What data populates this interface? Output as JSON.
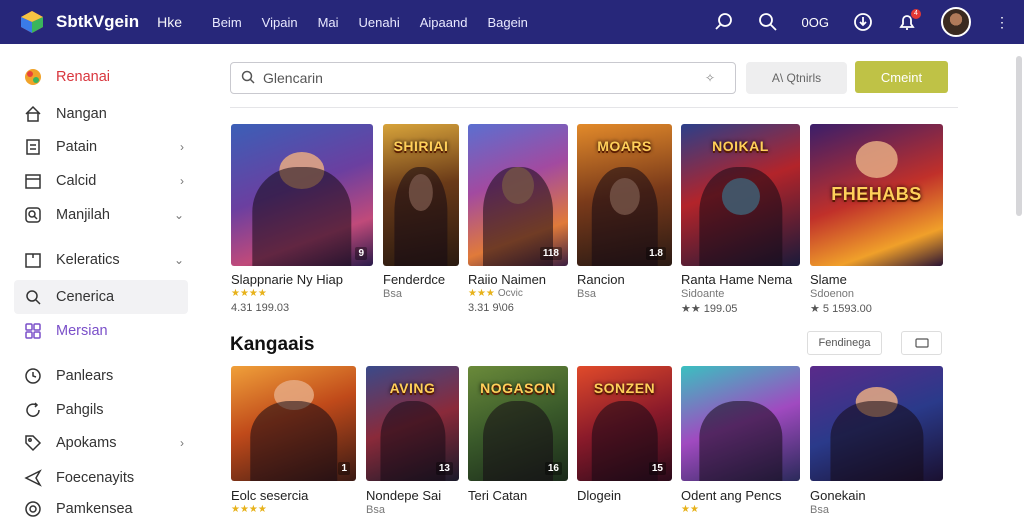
{
  "header": {
    "brand": "SbtkVgein",
    "brand_sub": "Hke",
    "nav": [
      "Beim",
      "Vipain",
      "Mai",
      "Uenahi",
      "Aipaand",
      "Bagein"
    ],
    "count": "0OG",
    "notification_badge": "4",
    "accent": "#27277a"
  },
  "sidebar": {
    "items": [
      {
        "label": "Renanai",
        "icon": "joystick-icon"
      },
      {
        "label": "Nangan",
        "icon": "home-icon"
      },
      {
        "label": "Patain",
        "icon": "document-icon",
        "chevron": "›"
      },
      {
        "label": "Calcid",
        "icon": "calendar-icon",
        "chevron": "›"
      },
      {
        "label": "Manjilah",
        "icon": "search-icon",
        "chevron": "⌄"
      },
      {
        "label": "Keleratics",
        "icon": "box-icon",
        "chevron": "⌄"
      },
      {
        "label": "Cenerica",
        "icon": "search-icon"
      },
      {
        "label": "Mersian",
        "icon": "grid-icon"
      },
      {
        "label": "Panlears",
        "icon": "clock-icon"
      },
      {
        "label": "Pahgils",
        "icon": "refresh-icon"
      },
      {
        "label": "Apokams",
        "icon": "tag-icon",
        "chevron": "›"
      },
      {
        "label": "Foecenayits",
        "icon": "send-icon"
      },
      {
        "label": "Pamkensea",
        "icon": "settings-icon"
      }
    ]
  },
  "toolbar": {
    "search_placeholder": "Glencarin",
    "filter_label": "A\\ Qtnirls",
    "cta_label": "Cmeint"
  },
  "row1": [
    {
      "name": "Slappnarie Ny Hiap",
      "stars": "★★★★",
      "meta": "",
      "price": "4.31 199.03",
      "tag": "9",
      "cover_title": ""
    },
    {
      "name": "Fenderdce",
      "stars": "",
      "meta": "Bsa",
      "price": "",
      "tag": "",
      "cover_title": "SHIRIAI"
    },
    {
      "name": "Raiio Naimen",
      "stars": "★★★",
      "meta": "Ocvic",
      "price": "3.31 9\\06",
      "tag": "118",
      "cover_title": ""
    },
    {
      "name": "Rancion",
      "stars": "",
      "meta": "Bsa",
      "price": "",
      "tag": "1.8",
      "cover_title": "MOARS"
    },
    {
      "name": "Ranta Hame Nema",
      "stars": "★★",
      "meta": "Sidoante",
      "price": "★★ 199.05",
      "tag": "",
      "cover_title": "NOIKAL"
    },
    {
      "name": "Slame",
      "stars": "",
      "meta": "Sdoenon",
      "price": "★ 5 1593.00",
      "tag": "",
      "cover_title": "FHEHABS"
    }
  ],
  "section": {
    "title": "Kangaais",
    "sort_label": "Fendinega"
  },
  "row2": [
    {
      "name": "Eolc sesercia",
      "stars": "★★★★",
      "meta": "",
      "tag": "1",
      "cover_title": ""
    },
    {
      "name": "Nondepe Sai",
      "stars": "",
      "meta": "Bsa",
      "tag": "13",
      "cover_title": "AVING"
    },
    {
      "name": "Teri Catan",
      "stars": "",
      "meta": "",
      "tag": "16",
      "cover_title": "NOGASON"
    },
    {
      "name": "Dlogein",
      "stars": "",
      "meta": "",
      "tag": "15",
      "cover_title": "SONZEN"
    },
    {
      "name": "Odent ang Pencs",
      "stars": "★★",
      "meta": "",
      "tag": "",
      "cover_title": ""
    },
    {
      "name": "Gonekain",
      "stars": "",
      "meta": "Bsa",
      "tag": "",
      "cover_title": ""
    }
  ],
  "colors": {
    "accent_red": "#d9363e",
    "accent_purple": "#7a4fc9",
    "cta": "#bfc246",
    "star": "#e7b21b"
  }
}
